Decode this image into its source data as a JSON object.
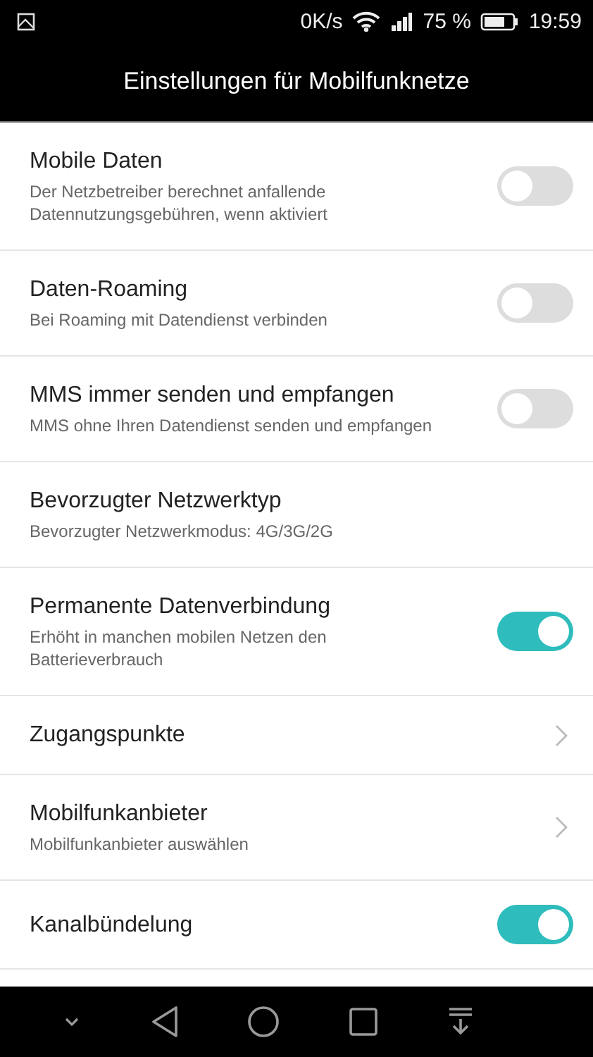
{
  "status_bar": {
    "speed": "0K/s",
    "battery": "75 %",
    "time": "19:59"
  },
  "title": "Einstellungen für Mobilfunknetze",
  "settings": [
    {
      "kind": "toggle",
      "title": "Mobile Daten",
      "subtitle": "Der Netzbetreiber berechnet anfallende Datennutzungsgebühren, wenn aktiviert",
      "on": false
    },
    {
      "kind": "toggle",
      "title": "Daten-Roaming",
      "subtitle": "Bei Roaming mit Datendienst verbinden",
      "on": false
    },
    {
      "kind": "toggle",
      "title": "MMS immer senden und empfangen",
      "subtitle": "MMS ohne Ihren Datendienst senden und empfangen",
      "on": false
    },
    {
      "kind": "plain",
      "title": "Bevorzugter Netzwerktyp",
      "subtitle": "Bevorzugter Netzwerkmodus: 4G/3G/2G"
    },
    {
      "kind": "toggle",
      "title": "Permanente Datenverbindung",
      "subtitle": "Erhöht in manchen mobilen Netzen den Batterieverbrauch",
      "on": true
    },
    {
      "kind": "chevron",
      "title": "Zugangspunkte"
    },
    {
      "kind": "chevron",
      "title": "Mobilfunkanbieter",
      "subtitle": "Mobilfunkanbieter auswählen"
    },
    {
      "kind": "toggle",
      "title": "Kanalbündelung",
      "on": true
    }
  ]
}
